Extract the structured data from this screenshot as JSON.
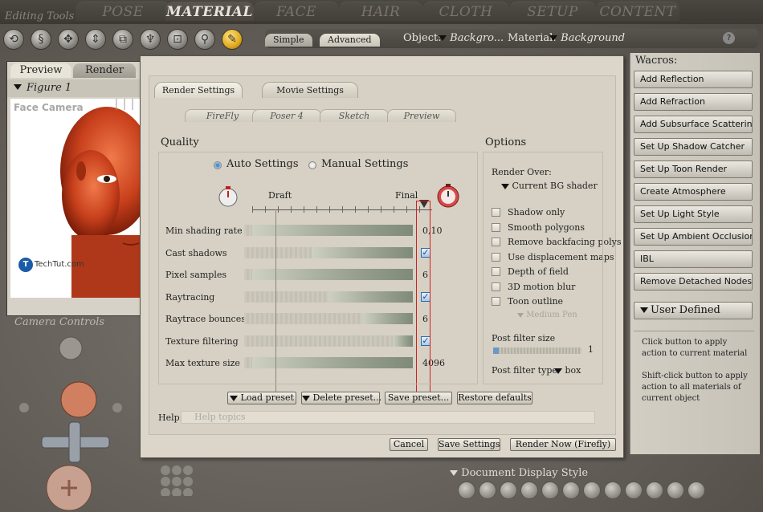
{
  "room_tabs": [
    "POSE",
    "MATERIAL",
    "FACE",
    "HAIR",
    "CLOTH",
    "SETUP",
    "CONTENT"
  ],
  "active_room": "MATERIAL",
  "editing_tools_label": "Editing Tools",
  "material_header": {
    "tabs": [
      "Simple",
      "Advanced"
    ],
    "active_tab": "Advanced",
    "object_label": "Object:",
    "object_value": "Backgro...",
    "material_label": "Material:",
    "material_value": "Background",
    "help_glyph": "?"
  },
  "preview": {
    "tabs": [
      "Preview",
      "Render"
    ],
    "active_tab": "Preview",
    "figure_label": "Figure 1",
    "camera_label": "Face Camera",
    "watermark": "TechTut.com"
  },
  "camera_controls_label": "Camera Controls",
  "wacros": {
    "title": "Wacros:",
    "buttons": [
      "Add Reflection",
      "Add Refraction",
      "Add Subsurface Scattering",
      "Set Up Shadow Catcher",
      "Set Up Toon Render",
      "Create Atmosphere",
      "Set Up Light Style",
      "Set Up Ambient Occlusion",
      "IBL",
      "Remove Detached Nodes"
    ],
    "user_defined": "User Defined",
    "help_1": "Click button to apply action to current material",
    "help_2": "Shift-click button to apply action to all materials of current object"
  },
  "dialog": {
    "tabs": [
      "Render Settings",
      "Movie Settings"
    ],
    "active_tab": "Render Settings",
    "render_tabs": [
      "FireFly",
      "Poser 4",
      "Sketch",
      "Preview"
    ],
    "active_render_tab": "FireFly",
    "quality": {
      "title": "Quality",
      "auto_label": "Auto Settings",
      "manual_label": "Manual Settings",
      "selected_mode": "Auto Settings",
      "draft_label": "Draft",
      "final_label": "Final",
      "rows": [
        {
          "label": "Min shading rate",
          "value": "0,10",
          "fill": 0.95,
          "check": false
        },
        {
          "label": "Cast shadows",
          "value": "",
          "fill": 0.6,
          "check": true
        },
        {
          "label": "Pixel samples",
          "value": "6",
          "fill": 0.95,
          "check": false
        },
        {
          "label": "Raytracing",
          "value": "",
          "fill": 0.5,
          "check": true
        },
        {
          "label": "Raytrace bounces",
          "value": "6",
          "fill": 0.3,
          "check": false
        },
        {
          "label": "Texture filtering",
          "value": "",
          "fill": 0.12,
          "check": true
        },
        {
          "label": "Max texture size",
          "value": "4096",
          "fill": 0.95,
          "check": false
        }
      ]
    },
    "options": {
      "title": "Options",
      "render_over_label": "Render Over:",
      "render_over_value": "Current BG shader",
      "checkboxes": [
        "Shadow only",
        "Smooth polygons",
        "Remove backfacing polys",
        "Use displacement maps",
        "Depth of field",
        "3D motion blur",
        "Toon outline"
      ],
      "pen_value": "Medium Pen",
      "post_filter_size_label": "Post filter size",
      "post_filter_size_value": "1",
      "post_filter_size_level": 0.06,
      "post_filter_type_label": "Post filter type",
      "post_filter_type_value": "box"
    },
    "preset_buttons": [
      "Load preset",
      "Delete preset...",
      "Save preset...",
      "Restore defaults"
    ],
    "help_label": "Help:",
    "help_placeholder": "Help topics",
    "footer_buttons": [
      "Cancel",
      "Save Settings",
      "Render Now (Firefly)"
    ]
  },
  "doc_display_label": "Document Display Style"
}
